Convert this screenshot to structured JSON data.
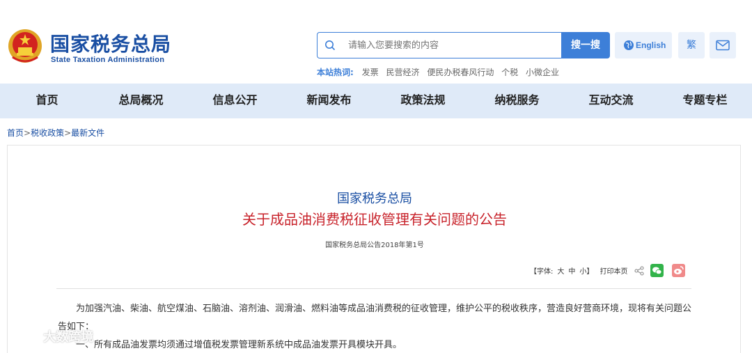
{
  "header": {
    "logo_cn": "国家税务总局",
    "logo_en": "State Taxation Administration",
    "search_placeholder": "请输入您要搜索的内容",
    "search_button": "搜一搜",
    "english_button": "English",
    "traditional_button": "繁",
    "hot_label": "本站热词:",
    "hot_words": [
      "发票",
      "民营经济",
      "便民办税春风行动",
      "个税",
      "小微企业"
    ]
  },
  "nav": {
    "items": [
      "首页",
      "总局概况",
      "信息公开",
      "新闻发布",
      "政策法规",
      "纳税服务",
      "互动交流",
      "专题专栏"
    ]
  },
  "breadcrumb": {
    "items": [
      "首页",
      "税收政策",
      "最新文件"
    ],
    "separator": ">"
  },
  "article": {
    "issuer": "国家税务总局",
    "title": "关于成品油消费税征收管理有关问题的公告",
    "doc_number": "国家税务总局公告2018年第1号",
    "font_label": "【字体:",
    "font_large": "大",
    "font_medium": "中",
    "font_small": "小】",
    "print_label": "打印本页",
    "paragraph_1": "为加强汽油、柴油、航空煤油、石脑油、溶剂油、润滑油、燃料油等成品油消费税的征收管理，维护公平的税收秩序，营造良好营商环境，现将有关问题公告如下：",
    "paragraph_2": "一、所有成品油发票均须通过增值税发票管理新系统中成品油发票开具模块开具。"
  },
  "watermark": {
    "text": "大数跨境"
  },
  "colors": {
    "brand_blue": "#1a4fa3",
    "accent_blue": "#3d7fd8",
    "nav_bg": "#dfeaf8",
    "title_red": "#c8232b",
    "wechat_green": "#32b34a",
    "weibo_pink": "#f08a8a"
  },
  "icons": {
    "emblem": "national-emblem-icon",
    "search": "search-icon",
    "globe": "globe-icon",
    "mail": "mail-icon",
    "share": "share-icon",
    "wechat": "wechat-icon",
    "weibo": "weibo-icon"
  }
}
